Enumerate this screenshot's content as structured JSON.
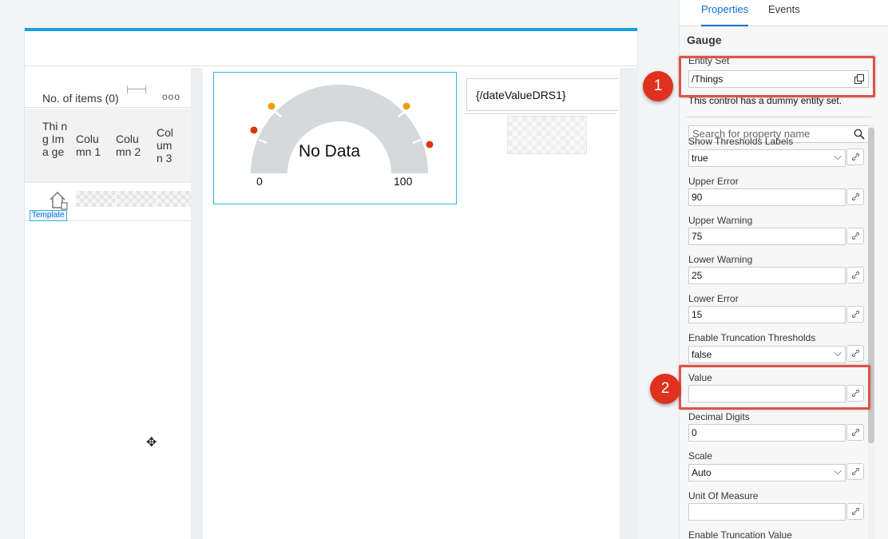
{
  "table": {
    "items_count": "No. of items (0)",
    "overflow": "ooo",
    "columns": [
      "Thi ng Ima ge",
      "Colu mn 1",
      "Colu mn 2",
      "Col um n 3"
    ],
    "template_tag": "Template"
  },
  "gauge": {
    "no_data": "No Data",
    "min_label": "0",
    "max_label": "100",
    "colors": {
      "track": "#d5d9dc",
      "warning": "#f39c12",
      "error": "#d9360b"
    }
  },
  "text_control": {
    "value": "{/dateValueDRS1}"
  },
  "panel": {
    "tabs": {
      "properties": "Properties",
      "events": "Events"
    },
    "title": "Gauge",
    "entity_set": {
      "label": "Entity Set",
      "value": "/Things"
    },
    "dummy_note": "This control has a dummy entity set.",
    "search_placeholder": "Search for property name",
    "show_thresholds_labels": {
      "label": "Show Thresholds Labels",
      "value": "true"
    },
    "upper_error": {
      "label": "Upper Error",
      "value": "90"
    },
    "upper_warning": {
      "label": "Upper Warning",
      "value": "75"
    },
    "lower_warning": {
      "label": "Lower Warning",
      "value": "25"
    },
    "lower_error": {
      "label": "Lower Error",
      "value": "15"
    },
    "enable_truncation_thresholds": {
      "label": "Enable Truncation Thresholds",
      "value": "false"
    },
    "value_field": {
      "label": "Value",
      "value": ""
    },
    "decimal_digits": {
      "label": "Decimal Digits",
      "value": "0"
    },
    "scale": {
      "label": "Scale",
      "value": "Auto"
    },
    "unit_of_measure": {
      "label": "Unit Of Measure",
      "value": ""
    },
    "enable_truncation_value": {
      "label": "Enable Truncation Value"
    }
  },
  "callouts": {
    "one": "1",
    "two": "2"
  },
  "highlight_color": "#e0524a",
  "accent_color": "#0a6ed1"
}
